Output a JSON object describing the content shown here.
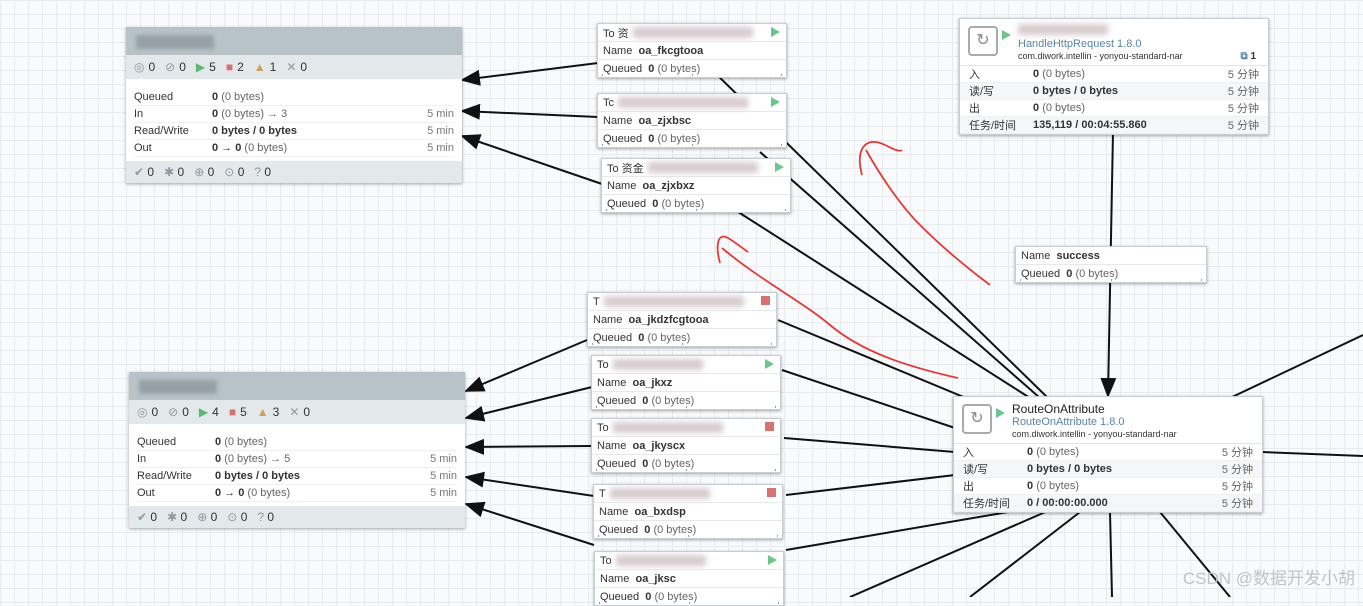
{
  "groups": [
    {
      "stats": {
        "running": "0",
        "stopped_groups": "0",
        "play": "5",
        "stop": "2",
        "warn": "1",
        "disabled": "0"
      },
      "rows": [
        {
          "label": "Queued",
          "value": "0",
          "extra": "(0 bytes)",
          "window": ""
        },
        {
          "label": "In",
          "value": "0",
          "extra": "(0 bytes) → 3",
          "window": "5 min"
        },
        {
          "label": "Read/Write",
          "value": "0 bytes / 0 bytes",
          "extra": "",
          "window": "5 min"
        },
        {
          "label": "Out",
          "value": "0 → 0",
          "extra": "(0 bytes)",
          "window": "5 min"
        }
      ],
      "footer": {
        "up_to_date": "0",
        "modified": "0",
        "stale": "0",
        "errors": "0",
        "unknown": "0"
      }
    },
    {
      "stats": {
        "running": "0",
        "stopped_groups": "0",
        "play": "4",
        "stop": "5",
        "warn": "3",
        "disabled": "0"
      },
      "rows": [
        {
          "label": "Queued",
          "value": "0",
          "extra": "(0 bytes)",
          "window": ""
        },
        {
          "label": "In",
          "value": "0",
          "extra": "(0 bytes) → 5",
          "window": "5 min"
        },
        {
          "label": "Read/Write",
          "value": "0 bytes / 0 bytes",
          "extra": "",
          "window": "5 min"
        },
        {
          "label": "Out",
          "value": "0 → 0",
          "extra": "(0 bytes)",
          "window": "5 min"
        }
      ],
      "footer": {
        "up_to_date": "0",
        "modified": "0",
        "stale": "0",
        "errors": "0",
        "unknown": "0"
      }
    }
  ],
  "connections": [
    {
      "to": "To 资",
      "name": "oa_fkcgtooa",
      "queued": "0",
      "queued_bytes": "(0 bytes)",
      "state": "play"
    },
    {
      "to": "Tc",
      "name": "oa_zjxbsc",
      "queued": "0",
      "queued_bytes": "(0 bytes)",
      "state": "play"
    },
    {
      "to": "To 资金",
      "name": "oa_zjxbxz",
      "queued": "0",
      "queued_bytes": "(0 bytes)",
      "state": "play"
    },
    {
      "to": "T",
      "name": "oa_jkdzfcgtooa",
      "queued": "0",
      "queued_bytes": "(0 bytes)",
      "state": "stop"
    },
    {
      "to": "To",
      "name": "oa_jkxz",
      "queued": "0",
      "queued_bytes": "(0 bytes)",
      "state": "play"
    },
    {
      "to": "To",
      "name": "oa_jkyscx",
      "queued": "0",
      "queued_bytes": "(0 bytes)",
      "state": "stop"
    },
    {
      "to": "T",
      "name": "oa_bxdsp",
      "queued": "0",
      "queued_bytes": "(0 bytes)",
      "state": "stop"
    },
    {
      "to": "To",
      "name": "oa_jksc",
      "queued": "0",
      "queued_bytes": "(0 bytes)",
      "state": "play"
    },
    {
      "to": "",
      "name": "success",
      "queued": "0",
      "queued_bytes": "(0 bytes)",
      "state": "none"
    }
  ],
  "labels": {
    "to_prefix": "To",
    "name": "Name",
    "queued": "Queued"
  },
  "processors": [
    {
      "name": "",
      "type": "HandleHttpRequest 1.8.0",
      "bundle": "com.diwork.intellin - yonyou-standard-nar",
      "badge": "1",
      "rows": [
        {
          "label": "入",
          "value": "0",
          "extra": "(0 bytes)",
          "window": "5 分钟"
        },
        {
          "label": "读/写",
          "value": "0 bytes / 0 bytes",
          "extra": "",
          "window": "5 分钟"
        },
        {
          "label": "出",
          "value": "0",
          "extra": "(0 bytes)",
          "window": "5 分钟"
        },
        {
          "label": "任务/时间",
          "value": "135,119 / 00:04:55.860",
          "extra": "",
          "window": "5 分钟"
        }
      ]
    },
    {
      "name": "RouteOnAttribute",
      "type": "RouteOnAttribute 1.8.0",
      "bundle": "com.diwork.intellin - yonyou-standard-nar",
      "badge": "",
      "rows": [
        {
          "label": "入",
          "value": "0",
          "extra": "(0 bytes)",
          "window": "5 分钟"
        },
        {
          "label": "读/写",
          "value": "0 bytes / 0 bytes",
          "extra": "",
          "window": "5 分钟"
        },
        {
          "label": "出",
          "value": "0",
          "extra": "(0 bytes)",
          "window": "5 分钟"
        },
        {
          "label": "任务/时间",
          "value": "0 / 00:00:00.000",
          "extra": "",
          "window": "5 分钟"
        }
      ]
    }
  ],
  "watermark": "CSDN @数据开发小胡",
  "colors": {
    "run": "#6cc58c",
    "stop": "#d67272",
    "warn": "#cf9f5d",
    "header": "#b8c3c9",
    "annotation": "#e53935"
  }
}
